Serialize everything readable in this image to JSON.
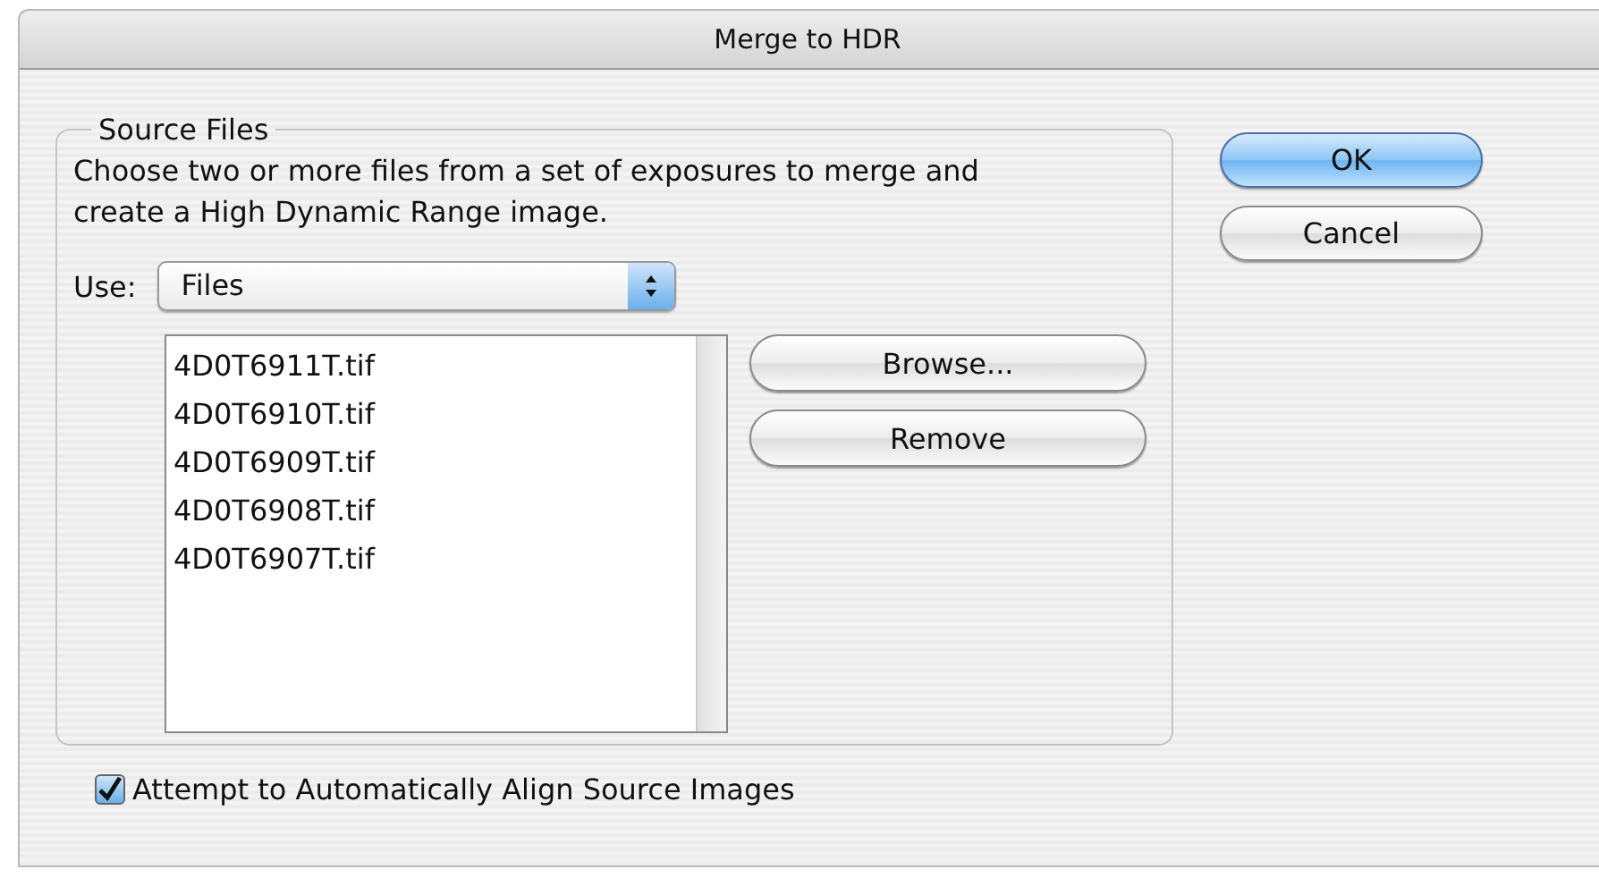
{
  "window": {
    "title": "Merge to HDR"
  },
  "source_files": {
    "legend": "Source Files",
    "description": "Choose two or more files from a set of exposures to merge and create a High Dynamic Range image.",
    "use_label": "Use:",
    "use_value": "Files",
    "files": [
      "4D0T6911T.tif",
      "4D0T6910T.tif",
      "4D0T6909T.tif",
      "4D0T6908T.tif",
      "4D0T6907T.tif"
    ],
    "buttons": [
      "Browse...",
      "Remove"
    ]
  },
  "dialog_buttons": [
    {
      "label": "OK",
      "default": true
    },
    {
      "label": "Cancel",
      "default": false
    }
  ],
  "align_checkbox": {
    "label": "Attempt to Automatically Align Source Images",
    "checked": true
  }
}
